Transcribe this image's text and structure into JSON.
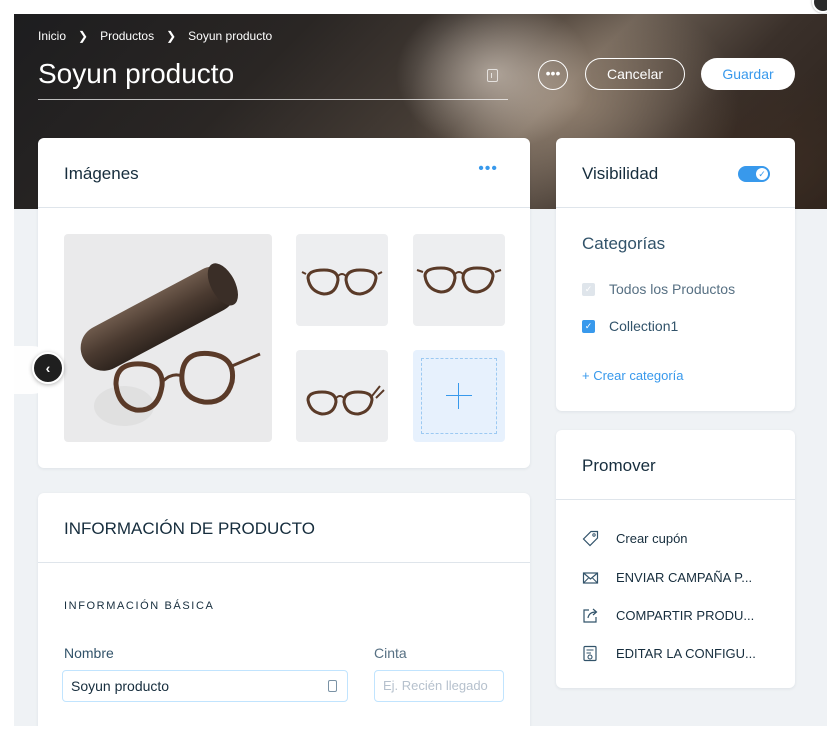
{
  "breadcrumb": {
    "items": [
      "Inicio",
      "Productos",
      "Soyun producto"
    ]
  },
  "header": {
    "title": "Soyun producto",
    "more_label": "•••",
    "cancel_label": "Cancelar",
    "save_label": "Guardar"
  },
  "images": {
    "title": "Imágenes",
    "more_label": "•••",
    "prev_label": "‹"
  },
  "product_info": {
    "title": "INFORMACIÓN DE PRODUCTO",
    "section_label": "INFORMACIÓN BÁSICA",
    "name_label": "Nombre",
    "name_value": "Soyun producto",
    "ribbon_label": "Cinta",
    "ribbon_placeholder": "Ej. Recién llegado"
  },
  "visibility": {
    "title": "Visibilidad",
    "enabled": true,
    "check_glyph": "✓"
  },
  "categories": {
    "title": "Categorías",
    "items": [
      {
        "label": "Todos los Productos",
        "checked": true,
        "disabled": true
      },
      {
        "label": "Collection1",
        "checked": true,
        "disabled": false
      }
    ],
    "create_label": "+ Crear categoría"
  },
  "promote": {
    "title": "Promover",
    "items": [
      {
        "label": "Crear cupón",
        "icon": "coupon-icon"
      },
      {
        "label": "ENVIAR CAMPAÑA P...",
        "icon": "mail-icon"
      },
      {
        "label": "COMPARTIR PRODU...",
        "icon": "share-icon"
      },
      {
        "label": "EDITAR LA CONFIGU...",
        "icon": "settings-icon"
      }
    ]
  },
  "colors": {
    "accent": "#3899ec",
    "text_dark": "#162d3d",
    "background": "#eff2f5"
  }
}
